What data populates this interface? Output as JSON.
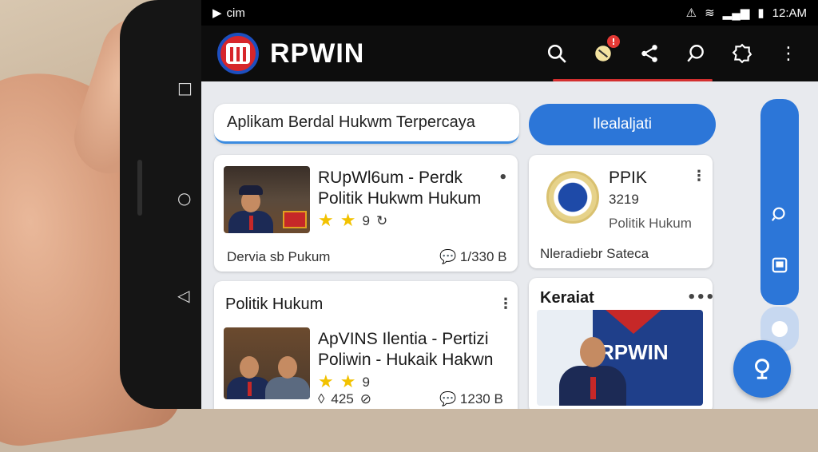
{
  "statusbar": {
    "left_text": "cim",
    "time": "12:AM"
  },
  "appbar": {
    "app_name": "RPWIN"
  },
  "search": {
    "value": "Aplikam Berdal Hukwm Terpercaya"
  },
  "cta": {
    "label": "Ilealaljati"
  },
  "card1": {
    "title_line1": "RUpWl6um - Perdk",
    "title_line2": "Politik Hukwm Hukum",
    "rating": "9",
    "footer_left": "Dervia sb Pukum",
    "footer_right": "1/330 B"
  },
  "card2": {
    "title": "PPIK",
    "number": "3219",
    "subtitle": "Politik Hukum",
    "footer": "Nleradiebr Sateca"
  },
  "card3": {
    "heading": "Politik Hukum",
    "title_line1": "ApVINS Ilentia - Pertizi",
    "title_line2": "Poliwin - Hukaik Hakwn",
    "rating": "9",
    "meta_left": "425",
    "footer_right": "1230 B"
  },
  "card4": {
    "heading": "Keraiat",
    "banner_text": "RPWIN"
  },
  "icons": {
    "search": "search-icon",
    "notification": "notification-icon",
    "share": "share-icon",
    "chat": "chat-icon",
    "settings": "settings-icon",
    "more": "more-icon"
  },
  "colors": {
    "accent": "#2c76d8",
    "brand_red": "#d7262b",
    "appbar": "#0d0d0d"
  }
}
